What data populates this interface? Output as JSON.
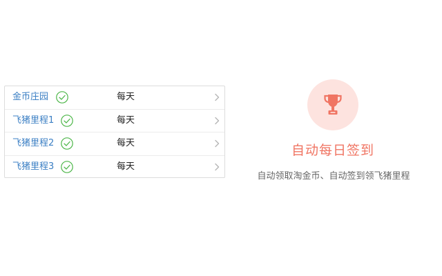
{
  "tasks": [
    {
      "name": "金币庄园",
      "frequency": "每天"
    },
    {
      "name": "飞猪里程1",
      "frequency": "每天"
    },
    {
      "name": "飞猪里程2",
      "frequency": "每天"
    },
    {
      "name": "飞猪里程3",
      "frequency": "每天"
    }
  ],
  "feature": {
    "title": "自动每日签到",
    "description": "自动领取淘金币、自动签到领飞猪里程",
    "icon": "trophy-icon"
  },
  "colors": {
    "link": "#3b7fc4",
    "check": "#4cb648",
    "accent": "#f07563",
    "accent_light": "#fde3df",
    "chevron": "#b5b5b5"
  }
}
